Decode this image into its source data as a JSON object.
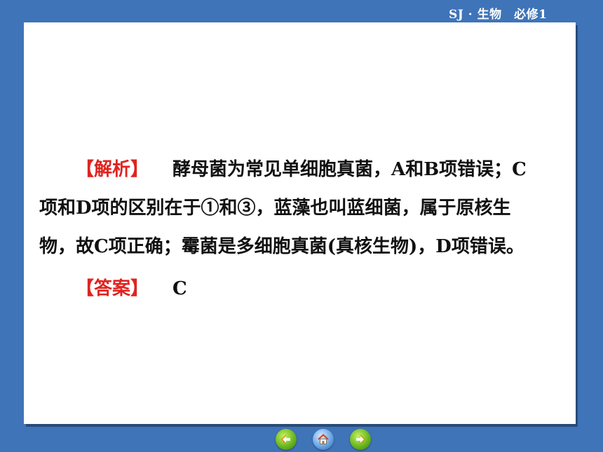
{
  "header": {
    "course_label": "SJ · 生物　必修1"
  },
  "analysis": {
    "tag": "【解析】",
    "lines": [
      "酵母菌为常见单细胞真菌，A和B项错误；C",
      "项和D项的区别在于①和③，蓝藻也叫蓝细菌，属于原核生",
      "物，故C项正确；霉菌是多细胞真菌(真核生物)，D项错误。"
    ]
  },
  "answer": {
    "tag": "【答案】",
    "value": "C"
  },
  "nav": {
    "prev_icon": "prev-arrow-icon",
    "home_icon": "home-icon",
    "next_icon": "next-arrow-icon"
  }
}
